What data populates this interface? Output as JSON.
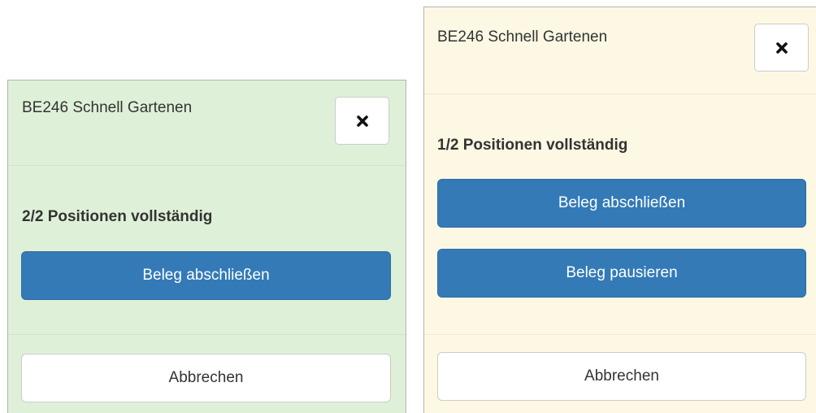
{
  "left_dialog": {
    "title": "BE246 Schnell Gartenen",
    "close_icon": "close-x-icon",
    "status": "2/2 Positionen vollständig",
    "complete_button": "Beleg abschließen",
    "cancel_button": "Abbrechen",
    "background_color": "#dff0d8"
  },
  "right_dialog": {
    "title": "BE246 Schnell Gartenen",
    "close_icon": "close-x-icon",
    "status": "1/2 Positionen vollständig",
    "complete_button": "Beleg abschließen",
    "pause_button": "Beleg pausieren",
    "cancel_button": "Abbrechen",
    "background_color": "#fcf8e3"
  },
  "colors": {
    "primary_button": "#337ab7",
    "primary_text": "#ffffff",
    "default_button": "#ffffff",
    "text": "#333333"
  }
}
